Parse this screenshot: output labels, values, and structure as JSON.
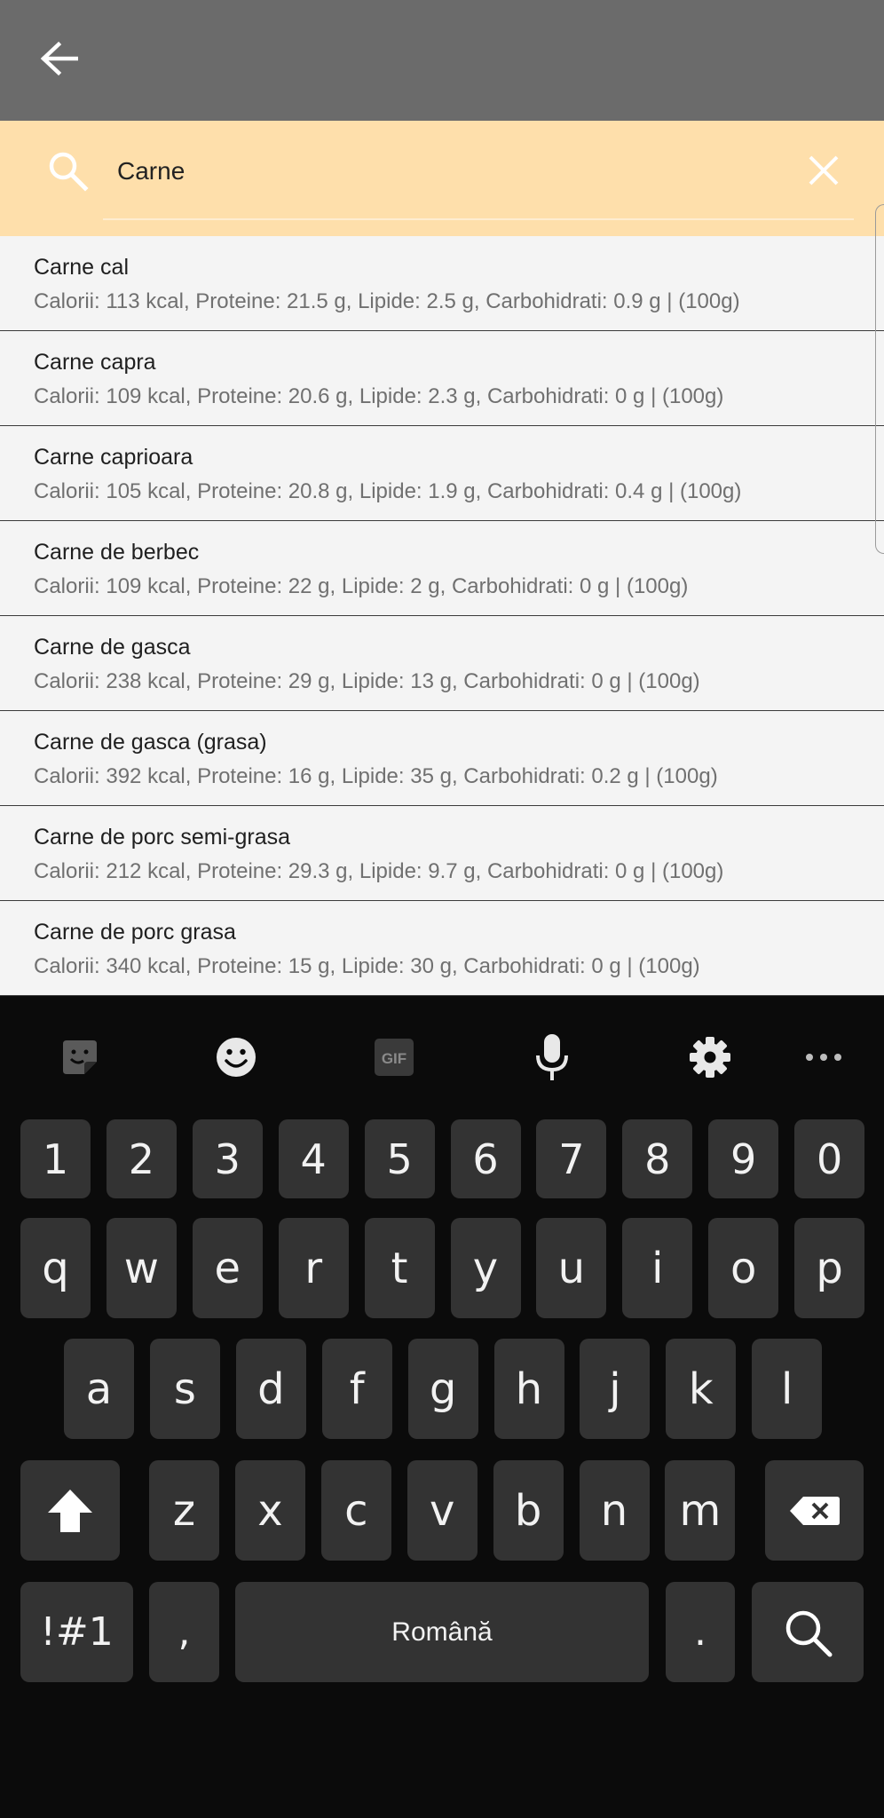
{
  "appbar": {
    "back_icon": "arrow-left-icon",
    "bg": "#6b6b6b"
  },
  "search": {
    "value": "Carne",
    "search_icon": "search-icon",
    "clear_icon": "close-icon",
    "bg": "#fedfab"
  },
  "results": [
    {
      "name": "Carne cal",
      "info": "Calorii: 113 kcal, Proteine: 21.5 g, Lipide: 2.5 g, Carbohidrati: 0.9 g | (100g)"
    },
    {
      "name": "Carne capra",
      "info": "Calorii: 109 kcal, Proteine: 20.6 g, Lipide: 2.3 g, Carbohidrati: 0 g | (100g)"
    },
    {
      "name": "Carne caprioara",
      "info": "Calorii: 105 kcal, Proteine: 20.8 g, Lipide: 1.9 g, Carbohidrati: 0.4 g | (100g)"
    },
    {
      "name": "Carne de berbec",
      "info": "Calorii: 109 kcal, Proteine: 22 g, Lipide: 2 g, Carbohidrati: 0 g | (100g)"
    },
    {
      "name": "Carne de gasca",
      "info": "Calorii: 238 kcal, Proteine: 29 g, Lipide: 13 g, Carbohidrati: 0 g | (100g)"
    },
    {
      "name": "Carne de gasca (grasa)",
      "info": "Calorii: 392 kcal, Proteine: 16 g, Lipide: 35 g, Carbohidrati: 0.2 g | (100g)"
    },
    {
      "name": "Carne de porc semi-grasa",
      "info": "Calorii: 212 kcal, Proteine: 29.3 g, Lipide: 9.7 g, Carbohidrati: 0 g | (100g)"
    },
    {
      "name": "Carne de porc grasa",
      "info": "Calorii: 340 kcal, Proteine: 15 g, Lipide: 30 g, Carbohidrati: 0 g | (100g)"
    }
  ],
  "keyboard": {
    "toolbar": [
      "sticker-icon",
      "emoji-icon",
      "gif-icon",
      "microphone-icon",
      "settings-icon",
      "more-icon"
    ],
    "gif_label": "GIF",
    "row_numbers": [
      "1",
      "2",
      "3",
      "4",
      "5",
      "6",
      "7",
      "8",
      "9",
      "0"
    ],
    "row_top": [
      "q",
      "w",
      "e",
      "r",
      "t",
      "y",
      "u",
      "i",
      "o",
      "p"
    ],
    "row_home": [
      "a",
      "s",
      "d",
      "f",
      "g",
      "h",
      "j",
      "k",
      "l"
    ],
    "row_bottom": [
      "z",
      "x",
      "c",
      "v",
      "b",
      "n",
      "m"
    ],
    "symbols_label": "!#1",
    "comma_label": ",",
    "space_label": "Română",
    "period_label": ".",
    "shift_icon": "shift-arrow-icon",
    "backspace_icon": "backspace-icon",
    "enter_icon": "search-icon"
  }
}
